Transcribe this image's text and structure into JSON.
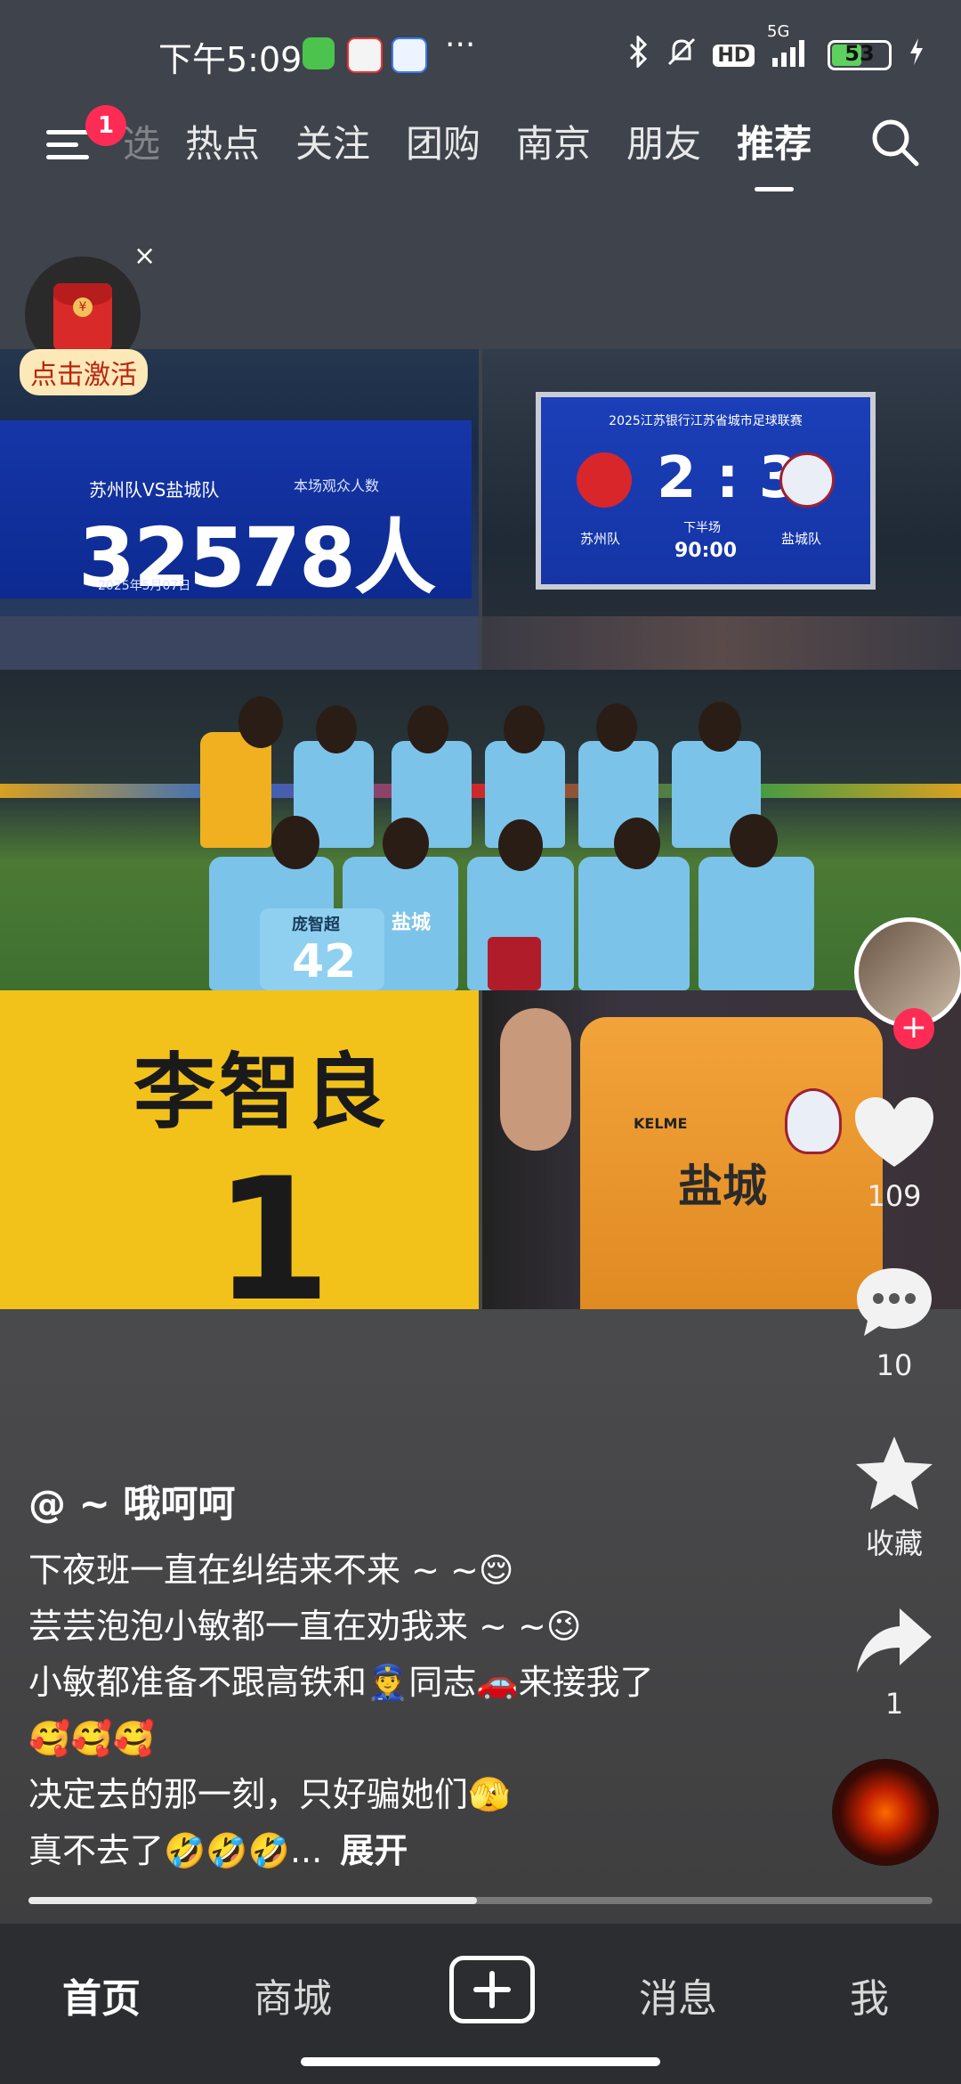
{
  "status_bar": {
    "time": "下午5:09",
    "dots": "···",
    "hd": "HD",
    "network": "5G",
    "battery_percent": "53",
    "battery_level": 0.53
  },
  "top_nav": {
    "menu_badge": "1",
    "tabs": [
      {
        "label": "热点"
      },
      {
        "label": "关注"
      },
      {
        "label": "团购"
      },
      {
        "label": "南京"
      },
      {
        "label": "朋友"
      },
      {
        "label": "推荐",
        "active": true
      }
    ],
    "faded_tab_fragment": "选"
  },
  "red_packet": {
    "label": "点击激活",
    "close": "×",
    "coin": "¥"
  },
  "photos": {
    "attendance_board": {
      "teams": "苏州队VS盐城队",
      "attendance_label": "本场观众人数",
      "attendance": "32578人",
      "date": "2025年5月07日"
    },
    "score_board": {
      "title": "2025江苏银行江苏省城市足球联赛",
      "home_team": "苏州队",
      "away_team": "盐城队",
      "score": "2 : 3",
      "half": "下半场",
      "time": "90:00"
    },
    "team_photo": {
      "shirt_name": "庞智超",
      "shirt_number": "42",
      "club_text": "盐城"
    },
    "yellow_shirt": {
      "name": "李智良",
      "number": "1"
    },
    "orange_shirt": {
      "text": "盐城",
      "brand": "KELME"
    }
  },
  "actions": {
    "follow": "+",
    "likes": "109",
    "comments": "10",
    "favorite_label": "收藏",
    "shares": "1"
  },
  "caption": {
    "author": "@ ~ 哦呵呵",
    "lines": [
      "下夜班一直在纠结来不来 ~ ~😌",
      "芸芸泡泡小敏都一直在劝我来 ~ ~😉",
      "小敏都准备不跟高铁和👮同志🚗来接我了",
      "🥰🥰🥰",
      "决定去的那一刻，只好骗她们🫣",
      "真不去了🤣🤣🤣..."
    ],
    "expand": "展开"
  },
  "progress": {
    "segments": 2,
    "current_segment": 1
  },
  "bottom_tabs": {
    "home": "首页",
    "mall": "商城",
    "messages": "消息",
    "me": "我"
  }
}
